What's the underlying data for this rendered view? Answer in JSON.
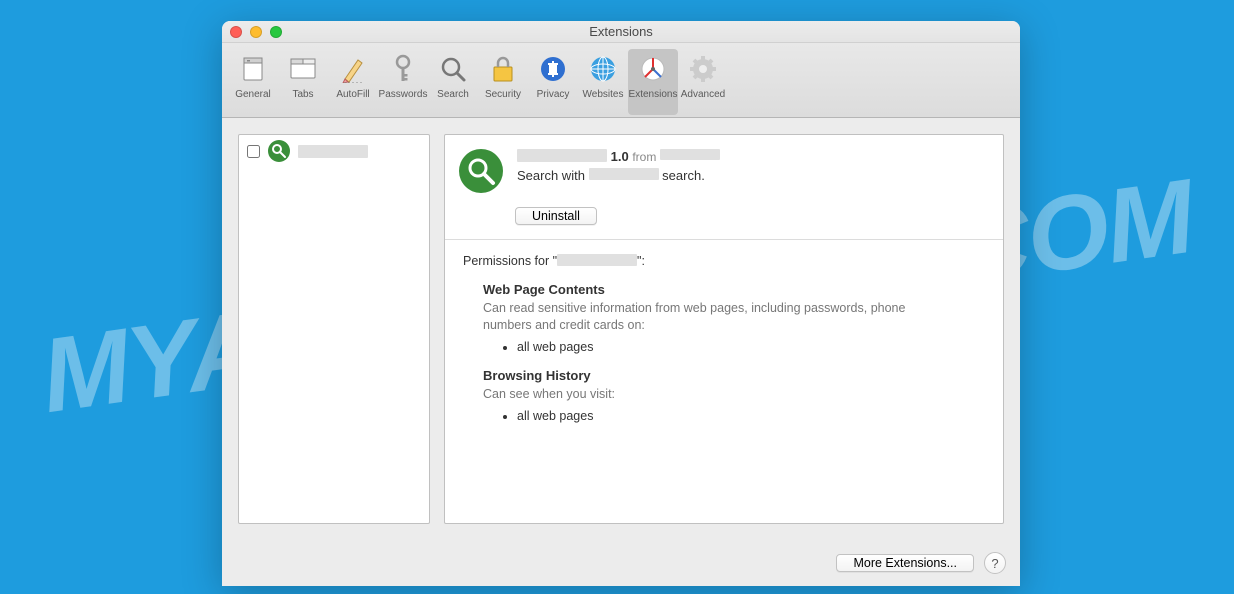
{
  "watermark": "MYANTISPYWARE.COM",
  "window": {
    "title": "Extensions"
  },
  "toolbar": [
    {
      "id": "general",
      "label": "General"
    },
    {
      "id": "tabs",
      "label": "Tabs"
    },
    {
      "id": "autofill",
      "label": "AutoFill"
    },
    {
      "id": "passwords",
      "label": "Passwords"
    },
    {
      "id": "search",
      "label": "Search"
    },
    {
      "id": "security",
      "label": "Security"
    },
    {
      "id": "privacy",
      "label": "Privacy"
    },
    {
      "id": "websites",
      "label": "Websites"
    },
    {
      "id": "extensions",
      "label": "Extensions",
      "active": true
    },
    {
      "id": "advanced",
      "label": "Advanced"
    }
  ],
  "sidebar": {
    "items": [
      {
        "name_redacted": true,
        "checked": false
      }
    ]
  },
  "extension": {
    "name_redacted": true,
    "version": "1.0",
    "from_label": "from",
    "vendor_redacted": true,
    "desc_prefix": "Search with",
    "desc_mid_redacted": true,
    "desc_suffix": "search.",
    "uninstall_label": "Uninstall"
  },
  "permissions": {
    "heading_prefix": "Permissions for \"",
    "heading_name_redacted": true,
    "heading_suffix": "\":",
    "sections": [
      {
        "title": "Web Page Contents",
        "desc": "Can read sensitive information from web pages, including passwords, phone numbers and credit cards on:",
        "items": [
          "all web pages"
        ]
      },
      {
        "title": "Browsing History",
        "desc": "Can see when you visit:",
        "items": [
          "all web pages"
        ]
      }
    ]
  },
  "footer": {
    "more_label": "More Extensions...",
    "help_label": "?"
  }
}
